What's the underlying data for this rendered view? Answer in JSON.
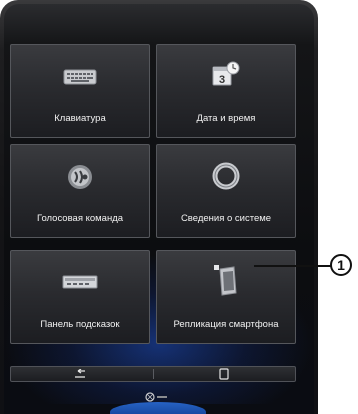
{
  "tiles": [
    {
      "label": "Клавиатура",
      "icon": "keyboard-icon"
    },
    {
      "label": "Дата и время",
      "icon": "calendar-clock-icon"
    },
    {
      "label": "Голосовая команда",
      "icon": "voice-command-icon"
    },
    {
      "label": "Сведения о системе",
      "icon": "system-info-icon"
    },
    {
      "label": "Панель подсказок",
      "icon": "hint-panel-icon"
    },
    {
      "label": "Репликация смартфона",
      "icon": "smartphone-replication-icon"
    }
  ],
  "calendar_day": "3",
  "bottom_bar": {
    "back_icon": "back-arrow-icon",
    "right_icon": "phone-icon"
  },
  "callout": {
    "number": "1"
  }
}
